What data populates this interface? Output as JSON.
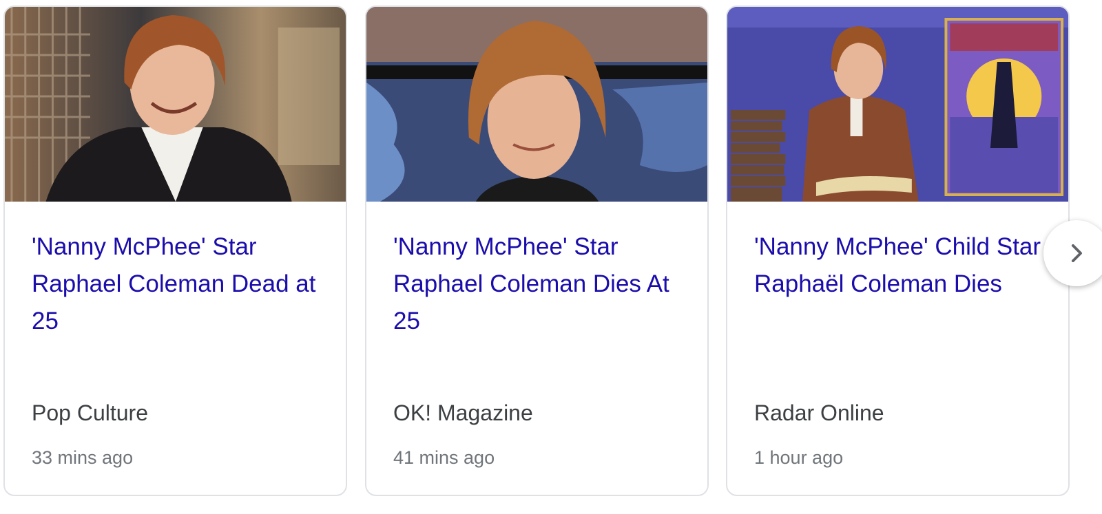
{
  "cards": [
    {
      "title": "'Nanny McPhee' Star Raphael Coleman Dead at 25",
      "source": "Pop Culture",
      "time": "33 mins ago"
    },
    {
      "title": "'Nanny McPhee' Star Raphael Coleman Dies At 25",
      "source": "OK! Magazine",
      "time": "41 mins ago"
    },
    {
      "title": "'Nanny McPhee' Child Star Raphaël Coleman Dies",
      "source": "Radar Online",
      "time": "1 hour ago"
    }
  ],
  "next_button": {
    "icon": "chevron-right-icon"
  },
  "colors": {
    "title_link": "#1a0dab",
    "source_text": "#3c4043",
    "time_text": "#70757a",
    "card_border": "#dfe1e5"
  }
}
